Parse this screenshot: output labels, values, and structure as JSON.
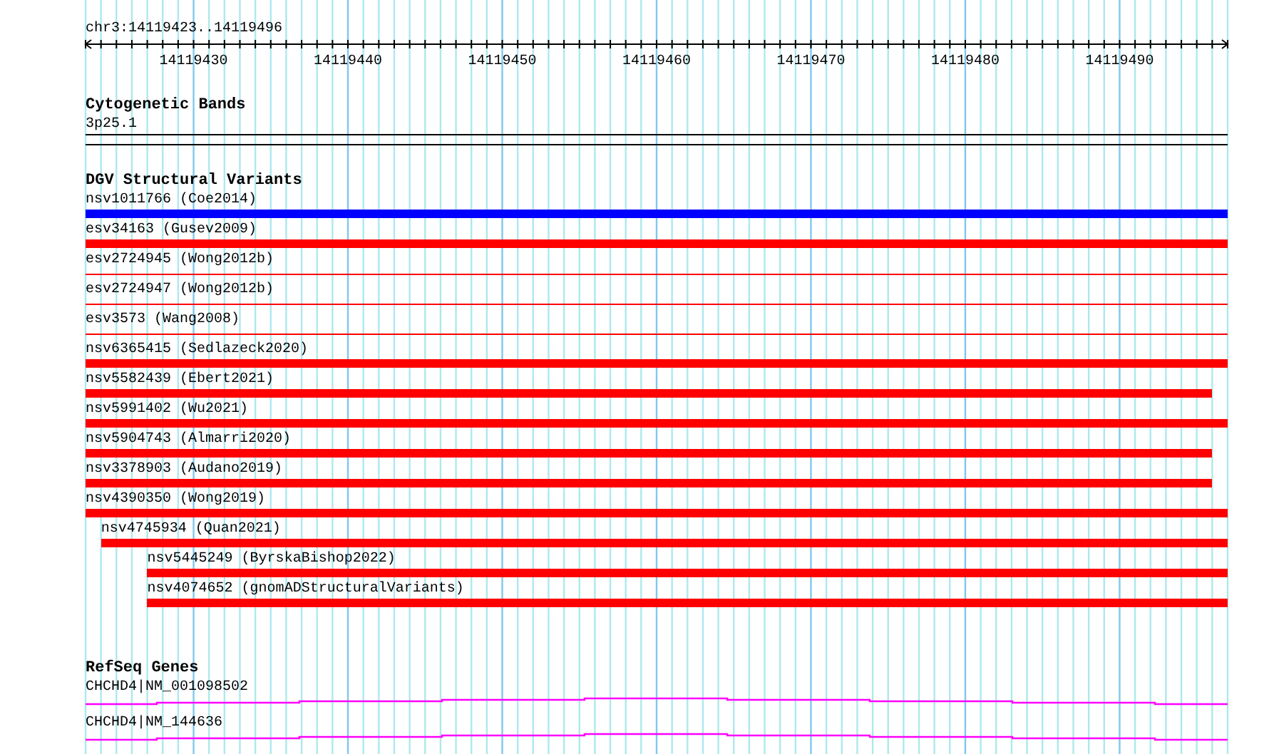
{
  "ruler": {
    "title": "chr3:14119423..14119496",
    "tick_labels": [
      "14119430",
      "14119440",
      "14119450",
      "14119460",
      "14119470",
      "14119480",
      "14119490"
    ]
  },
  "tracks": [
    {
      "kind": "cytoband",
      "title": "Cytogenetic Bands",
      "features": [
        {
          "label": "3p25.1"
        }
      ]
    },
    {
      "kind": "variants",
      "title": "DGV Structural Variants",
      "features": [
        {
          "label": "nsv1011766 (Coe2014)",
          "color": "#0000ff",
          "kind": "thick",
          "ends_inside": false
        },
        {
          "label": "esv34163 (Gusev2009)",
          "color": "#ff0000",
          "kind": "thick",
          "ends_inside": false
        },
        {
          "label": "esv2724945 (Wong2012b)",
          "color": "#ff0000",
          "kind": "thin",
          "ends_inside": false
        },
        {
          "label": "esv2724947 (Wong2012b)",
          "color": "#ff0000",
          "kind": "thin",
          "ends_inside": false
        },
        {
          "label": "esv3573 (Wang2008)",
          "color": "#ff0000",
          "kind": "thin",
          "ends_inside": false
        },
        {
          "label": "nsv6365415 (Sedlazeck2020)",
          "color": "#ff0000",
          "kind": "thick",
          "ends_inside": false
        },
        {
          "label": "nsv5582439 (Ebert2021)",
          "color": "#ff0000",
          "kind": "thick",
          "ends_inside": true
        },
        {
          "label": "nsv5991402 (Wu2021)",
          "color": "#ff0000",
          "kind": "thick",
          "ends_inside": false
        },
        {
          "label": "nsv5904743 (Almarri2020)",
          "color": "#ff0000",
          "kind": "thick",
          "ends_inside": true
        },
        {
          "label": "nsv3378903 (Audano2019)",
          "color": "#ff0000",
          "kind": "thick",
          "ends_inside": true
        },
        {
          "label": "nsv4390350 (Wong2019)",
          "color": "#ff0000",
          "kind": "thick",
          "ends_inside": false,
          "children": [
            {
              "label": "nsv4745934 (Quan2021)",
              "color": "#ff0000",
              "kind": "thick",
              "ends_inside": false,
              "children": [
                {
                  "label": "nsv5445249 (ByrskaBishop2022)",
                  "color": "#ff0000",
                  "kind": "thick",
                  "ends_inside": false
                },
                {
                  "label": "nsv4074652 (gnomADStructuralVariants)",
                  "color": "#ff0000",
                  "kind": "thick",
                  "ends_inside": false
                }
              ]
            }
          ]
        }
      ]
    },
    {
      "kind": "genes",
      "title": "RefSeq Genes",
      "features": [
        {
          "label": "CHCHD4|NM_001098502"
        },
        {
          "label": "CHCHD4|NM_144636"
        }
      ]
    }
  ]
}
